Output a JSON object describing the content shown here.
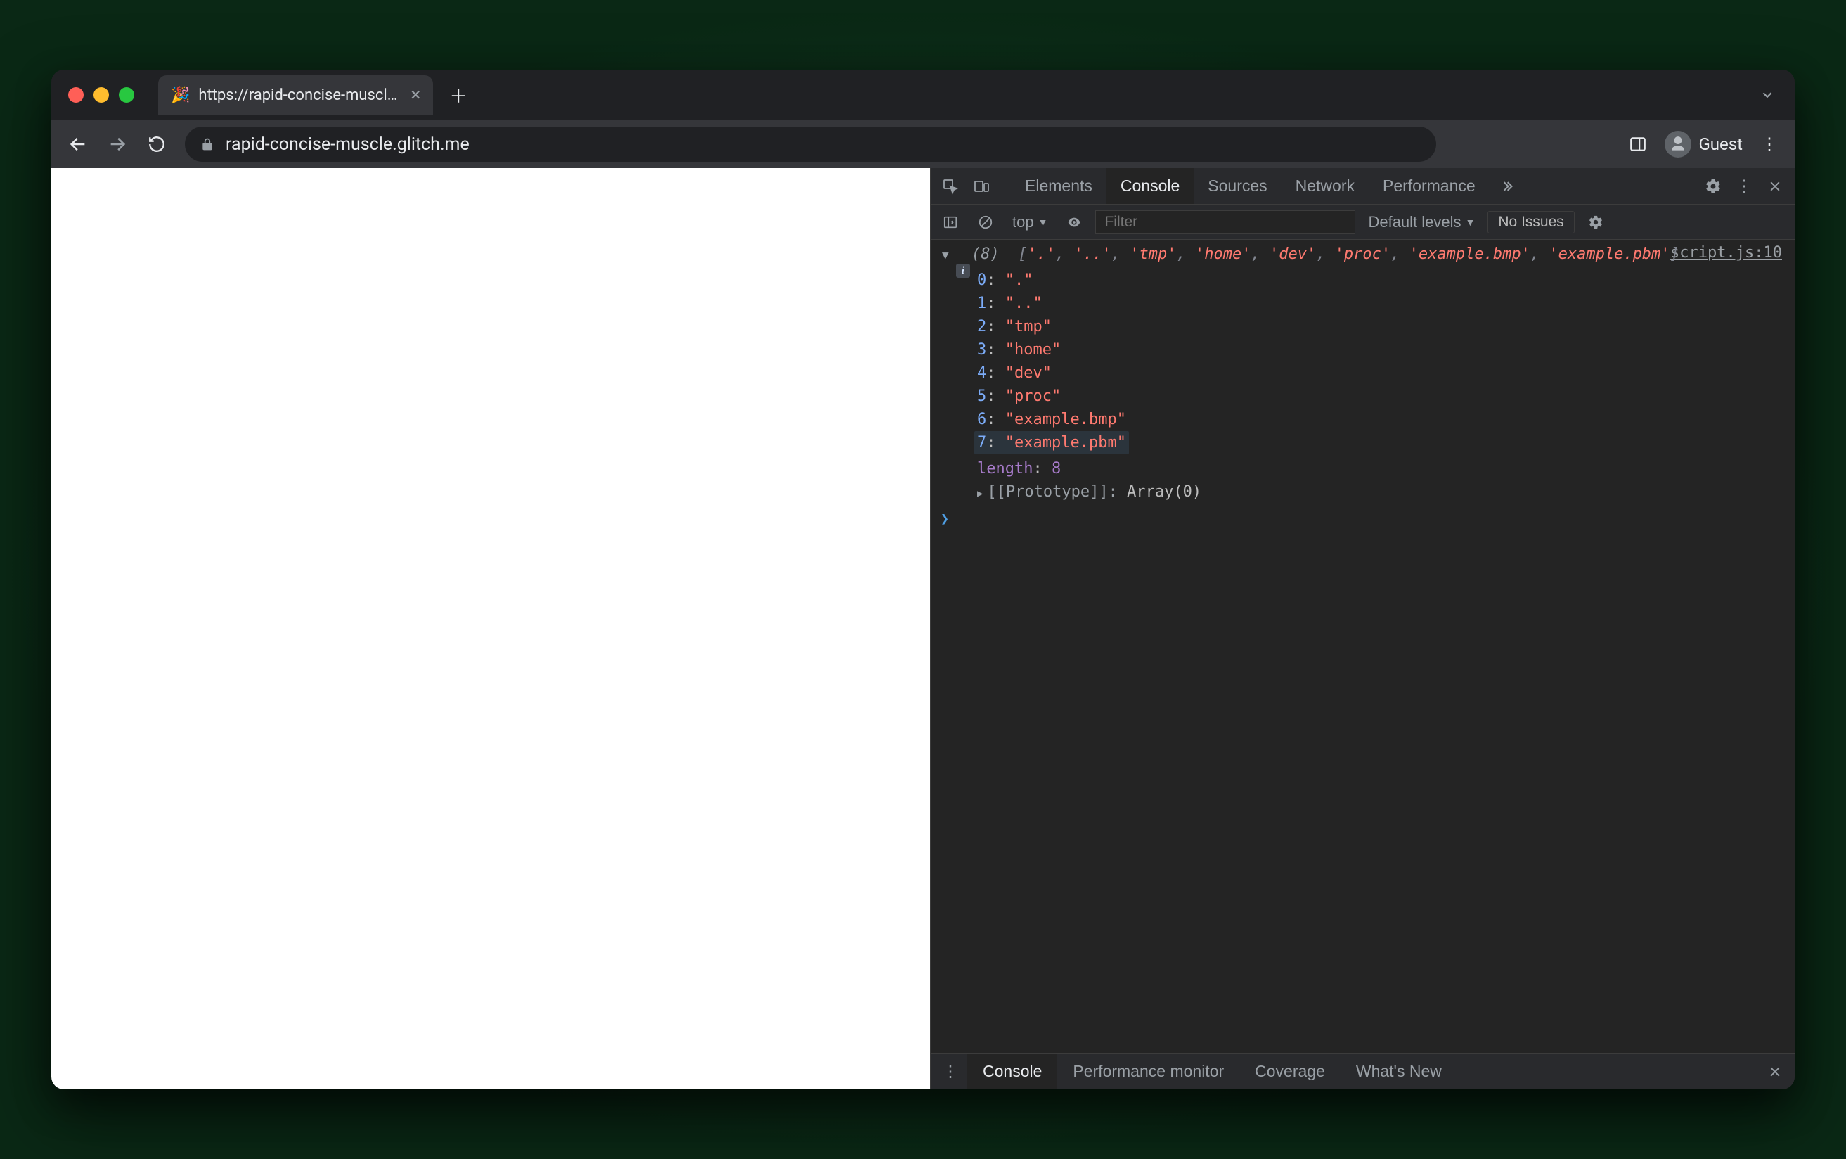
{
  "browser": {
    "tab": {
      "favicon": "🎉",
      "title": "https://rapid-concise-muscle.g"
    },
    "url": "rapid-concise-muscle.glitch.me",
    "profile_label": "Guest"
  },
  "devtools": {
    "tabs": [
      "Elements",
      "Console",
      "Sources",
      "Network",
      "Performance"
    ],
    "active_tab": "Console",
    "subbar": {
      "context": "top",
      "filter_placeholder": "Filter",
      "levels": "Default levels",
      "issues": "No Issues"
    },
    "console": {
      "source_link": "script.js:10",
      "array_length_label": "(8)",
      "array_preview": [
        "'.'",
        "'..'",
        "'tmp'",
        "'home'",
        "'dev'",
        "'proc'",
        "'example.bmp'",
        "'example.pbm'"
      ],
      "array_items": [
        {
          "index": "0",
          "value": "\".\""
        },
        {
          "index": "1",
          "value": "\"..\""
        },
        {
          "index": "2",
          "value": "\"tmp\""
        },
        {
          "index": "3",
          "value": "\"home\""
        },
        {
          "index": "4",
          "value": "\"dev\""
        },
        {
          "index": "5",
          "value": "\"proc\""
        },
        {
          "index": "6",
          "value": "\"example.bmp\""
        },
        {
          "index": "7",
          "value": "\"example.pbm\""
        }
      ],
      "highlighted_index": 7,
      "length_key": "length",
      "length_value": "8",
      "prototype_label": "[[Prototype]]",
      "prototype_value": "Array(0)"
    },
    "drawer": {
      "tabs": [
        "Console",
        "Performance monitor",
        "Coverage",
        "What's New"
      ],
      "active_tab": "Console"
    }
  }
}
